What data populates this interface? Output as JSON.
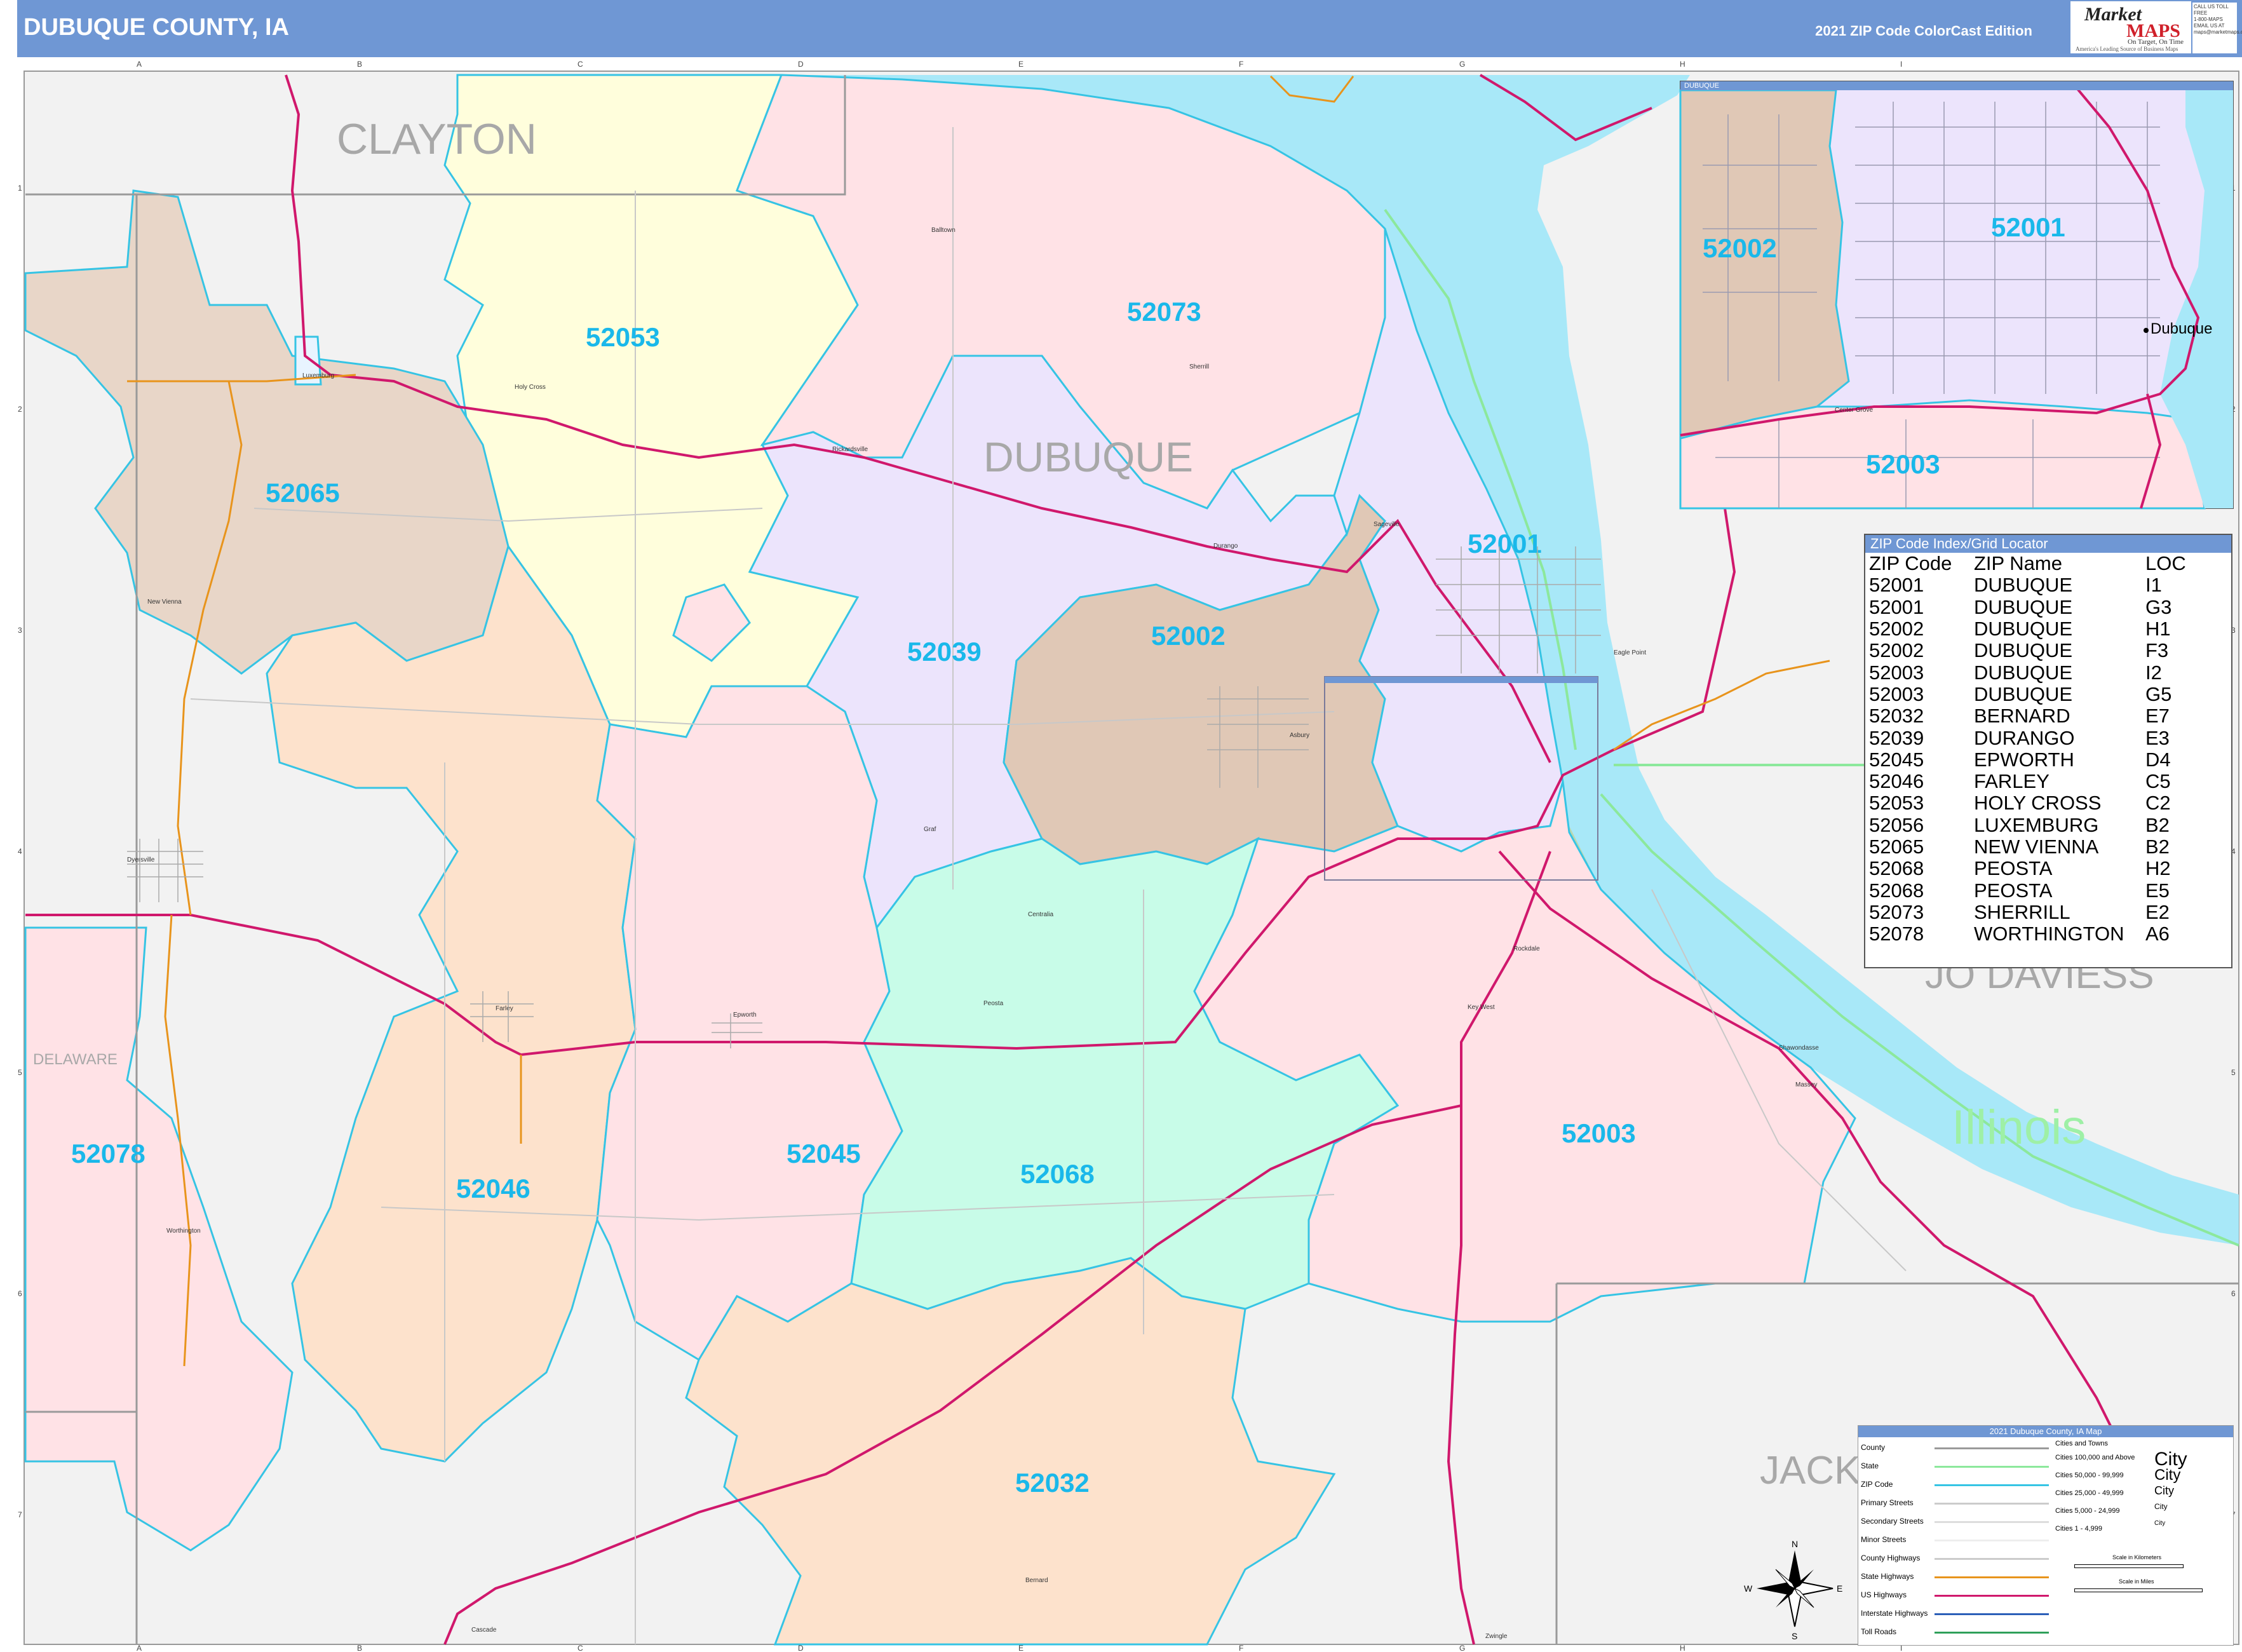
{
  "header": {
    "title": "DUBUQUE COUNTY, IA",
    "edition": "2021 ZIP Code ColorCast Edition"
  },
  "logo": {
    "line1": "Market",
    "line2": "MAPS",
    "tagline": "On Target, On Time",
    "sub": "America's Leading Source of Business Maps"
  },
  "contact": [
    "CALL US TOLL FREE",
    "1-800-MAPS",
    "EMAIL US AT",
    "maps@marketmaps.com"
  ],
  "colors": {
    "header": "#6f97d4",
    "water": "#a8e8f8",
    "zip_border": "#36c4e4",
    "zip_label": "#1ab8ea",
    "us_highway": "#d0186c",
    "state_highway": "#e8941c",
    "interstate": "#2c5fb8",
    "state_line": "#8ce89c"
  },
  "grid": {
    "cols": [
      "A",
      "B",
      "C",
      "D",
      "E",
      "F",
      "G",
      "H",
      "I"
    ],
    "rows": [
      "1",
      "2",
      "3",
      "4",
      "5",
      "6",
      "7"
    ]
  },
  "counties": [
    "CLAYTON",
    "DUBUQUE",
    "JO DAVIESS",
    "JACKSON",
    "DELAWARE"
  ],
  "county_labels": {
    "clayton": "CLAYTON",
    "dubuque": "DUBUQUE",
    "jodaviess": "JO DAVIESS",
    "jackson": "JACK",
    "delaware": "DELAWARE",
    "illinois": "Illinois"
  },
  "zip_labels": [
    "52053",
    "52073",
    "52065",
    "52039",
    "52002",
    "52001",
    "52078",
    "52046",
    "52045",
    "52068",
    "52003",
    "52032"
  ],
  "cities": [
    "Balltown",
    "Sherrill",
    "Luxemburg",
    "Holy Cross",
    "Rickardsville",
    "Durango",
    "Sageville",
    "New Vienna",
    "Dyersville",
    "Asbury",
    "Eagle Point",
    "Graf",
    "Centralia",
    "Peosta",
    "Epworth",
    "Farley",
    "Worthington",
    "Key West",
    "Rockdale",
    "Shawondasse",
    "Massey",
    "Bernard",
    "Cascade",
    "Zwingle",
    "Dubuque",
    "Center Grove"
  ],
  "inset": {
    "title": "DUBUQUE",
    "zips": [
      "52002",
      "52001",
      "52003"
    ],
    "city": "Dubuque",
    "street": "Center Grove"
  },
  "index": {
    "title": "ZIP Code Index/Grid Locator",
    "headers": [
      "ZIP Code",
      "ZIP Name",
      "LOC"
    ],
    "rows": [
      [
        "52001",
        "DUBUQUE",
        "I1"
      ],
      [
        "52001",
        "DUBUQUE",
        "G3"
      ],
      [
        "52002",
        "DUBUQUE",
        "H1"
      ],
      [
        "52002",
        "DUBUQUE",
        "F3"
      ],
      [
        "52003",
        "DUBUQUE",
        "I2"
      ],
      [
        "52003",
        "DUBUQUE",
        "G5"
      ],
      [
        "52032",
        "BERNARD",
        "E7"
      ],
      [
        "52039",
        "DURANGO",
        "E3"
      ],
      [
        "52045",
        "EPWORTH",
        "D4"
      ],
      [
        "52046",
        "FARLEY",
        "C5"
      ],
      [
        "52053",
        "HOLY CROSS",
        "C2"
      ],
      [
        "52056",
        "LUXEMBURG",
        "B2"
      ],
      [
        "52065",
        "NEW VIENNA",
        "B2"
      ],
      [
        "52068",
        "PEOSTA",
        "H2"
      ],
      [
        "52068",
        "PEOSTA",
        "E5"
      ],
      [
        "52073",
        "SHERRILL",
        "E2"
      ],
      [
        "52078",
        "WORTHINGTON",
        "A6"
      ]
    ]
  },
  "legend": {
    "title": "2021 Dubuque County, IA Map",
    "items": [
      "County",
      "State",
      "ZIP Code",
      "Primary Streets",
      "Secondary Streets",
      "Minor Streets",
      "County Highways",
      "State Highways",
      "US Highways",
      "Interstate Highways",
      "Toll Roads"
    ],
    "cities_title": "Cities and Towns",
    "city_classes": [
      "Cities 100,000 and Above",
      "Cities 50,000 - 99,999",
      "Cities 25,000 - 49,999",
      "Cities 5,000 - 24,999",
      "Cities 1 - 4,999"
    ],
    "city_sample": "City",
    "scale_km": "Scale in Kilometers",
    "scale_mi": "Scale in Miles"
  },
  "compass": {
    "n": "N",
    "s": "S",
    "e": "E",
    "w": "W"
  }
}
